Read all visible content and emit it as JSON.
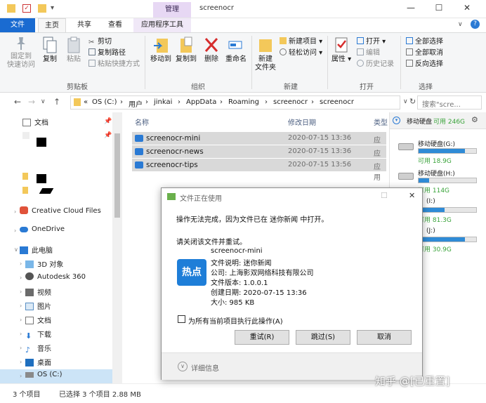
{
  "window": {
    "title": "screenocr",
    "manage_tab": "管理",
    "controls": {
      "minimize": "—",
      "maximize": "☐",
      "close": "✕"
    }
  },
  "tabs": {
    "file": "文件",
    "home": "主页",
    "share": "共享",
    "view": "查看",
    "app_tools": "应用程序工具"
  },
  "ribbon": {
    "pin": "固定到\n快速访问",
    "copy": "复制",
    "paste": "粘贴",
    "cut": "剪切",
    "copy_path": "复制路径",
    "paste_shortcut": "粘贴快捷方式",
    "group_clipboard": "剪贴板",
    "move_to": "移动到",
    "copy_to": "复制到",
    "delete": "删除",
    "rename": "重命名",
    "group_organize": "组织",
    "new_folder": "新建\n文件夹",
    "new_item": "新建项目",
    "easy_access": "轻松访问",
    "group_new": "新建",
    "properties": "属性",
    "open": "打开",
    "edit": "编辑",
    "history": "历史记录",
    "group_open": "打开",
    "select_all": "全部选择",
    "select_none": "全部取消",
    "invert_selection": "反向选择",
    "group_select": "选择"
  },
  "address": {
    "segments": [
      "«",
      "OS (C:)",
      "›",
      "用户",
      "›",
      "jinkai",
      "›",
      "AppData",
      "›",
      "Roaming",
      "›",
      "screenocr",
      "›",
      "screenocr"
    ],
    "search_placeholder": "搜索\"scre..."
  },
  "sidebar": {
    "items": [
      {
        "label": "文档"
      },
      {
        "label": "Creative Cloud Files"
      },
      {
        "label": "OneDrive"
      },
      {
        "label": "此电脑"
      },
      {
        "label": "3D 对象"
      },
      {
        "label": "Autodesk 360"
      },
      {
        "label": "视频"
      },
      {
        "label": "图片"
      },
      {
        "label": "文档"
      },
      {
        "label": "下载"
      },
      {
        "label": "音乐"
      },
      {
        "label": "桌面"
      },
      {
        "label": "OS (C:)"
      }
    ]
  },
  "filelist": {
    "headers": {
      "name": "名称",
      "modified": "修改日期",
      "type": "类型"
    },
    "rows": [
      {
        "name": "screenocr-mini",
        "date": "2020-07-15 13:36",
        "type": "应用"
      },
      {
        "name": "screenocr-news",
        "date": "2020-07-15 13:36",
        "type": "应用"
      },
      {
        "name": "screenocr-tips",
        "date": "2020-07-15 13:56",
        "type": "应用"
      }
    ]
  },
  "drives": {
    "header": "移动硬盘",
    "header_avail": "可用 246G",
    "items": [
      {
        "name": "移动硬盘(G:)",
        "avail": "可用 18.9G",
        "used_fraction": 0.8
      },
      {
        "name": "移动硬盘(H:)",
        "avail": "可用 114G",
        "used_fraction": 0.18
      },
      {
        "name": "(I:)",
        "avail": "可用 81.3G",
        "used_fraction": 0.45
      },
      {
        "name": "(J:)",
        "avail": "可用 30.9G",
        "used_fraction": 0.8
      }
    ]
  },
  "status": {
    "count": "3 个项目",
    "selected": "已选择 3 个项目 2.88 MB"
  },
  "dialog": {
    "title": "文件正在使用",
    "message": "操作无法完成，因为文件已在 迷你新闻 中打开。",
    "hint": "请关闭该文件并重试。",
    "app_icon_text": "热点",
    "file_name": "screenocr-mini",
    "file_desc": "文件说明: 迷你新闻",
    "company": "公司: 上海影双网络科技有限公司",
    "version": "文件版本: 1.0.0.1",
    "created": "创建日期: 2020-07-15 13:36",
    "size": "大小: 985 KB",
    "checkbox_label": "为所有当前项目执行此操作(A)",
    "retry": "重试(R)",
    "skip": "跳过(S)",
    "cancel": "取消",
    "details": "详细信息"
  },
  "watermark": "知乎 @[已重置]",
  "colors": {
    "accent": "#1a6bd1",
    "selection": "#d9d9d9",
    "manage": "#e7d8f4",
    "drive_fill": "#2f8bd6"
  }
}
